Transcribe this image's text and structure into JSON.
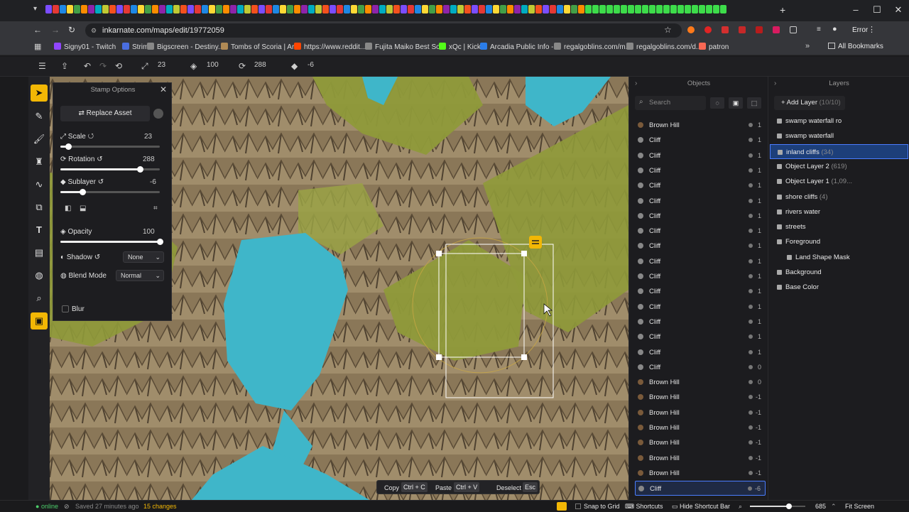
{
  "browser": {
    "url": "inkarnate.com/maps/edit/19772059",
    "profile": "Error",
    "bookmarks": [
      {
        "label": "Signy01 - Twitch",
        "color": "#9146ff"
      },
      {
        "label": "Strims",
        "color": "#4a6ee0"
      },
      {
        "label": "Bigscreen - Destiny...",
        "color": "#888888"
      },
      {
        "label": "Tombs of Scoria | Ar...",
        "color": "#b08a55"
      },
      {
        "label": "https://www.reddit...",
        "color": "#ff4500"
      },
      {
        "label": "Fujita Maiko Best So...",
        "color": "#888888"
      },
      {
        "label": "xQc | Kick",
        "color": "#53fc18"
      },
      {
        "label": "Arcadia Public Info -...",
        "color": "#2b7de9"
      },
      {
        "label": "regalgoblins.com/m...",
        "color": "#888888"
      },
      {
        "label": "regalgoblins.com/d...",
        "color": "#888888"
      },
      {
        "label": "patron",
        "color": "#f96854"
      }
    ],
    "all_bookmarks": "All Bookmarks"
  },
  "toolbar": {
    "scale_value": "23",
    "opacity_value": "100",
    "rotation_value": "288",
    "sublayer_value": "-6"
  },
  "stamp_options": {
    "title": "Stamp Options",
    "replace_asset": "Replace Asset",
    "scale_label": "Scale",
    "scale_value": "23",
    "scale_frac": 0.08,
    "rotation_label": "Rotation",
    "rotation_value": "288",
    "rotation_frac": 0.8,
    "sublayer_label": "Sublayer",
    "sublayer_value": "-6",
    "sublayer_frac": 0.22,
    "opacity_label": "Opacity",
    "opacity_value": "100",
    "opacity_frac": 1.0,
    "shadow_label": "Shadow",
    "shadow_value": "None",
    "blend_label": "Blend Mode",
    "blend_value": "Normal",
    "blur_label": "Blur"
  },
  "objects": {
    "title": "Objects",
    "search_placeholder": "Search",
    "items": [
      {
        "name": "Brown Hill",
        "count": "1"
      },
      {
        "name": "Cliff",
        "count": "1"
      },
      {
        "name": "Cliff",
        "count": "1"
      },
      {
        "name": "Cliff",
        "count": "1"
      },
      {
        "name": "Cliff",
        "count": "1"
      },
      {
        "name": "Cliff",
        "count": "1"
      },
      {
        "name": "Cliff",
        "count": "1"
      },
      {
        "name": "Cliff",
        "count": "1"
      },
      {
        "name": "Cliff",
        "count": "1"
      },
      {
        "name": "Cliff",
        "count": "1"
      },
      {
        "name": "Cliff",
        "count": "1"
      },
      {
        "name": "Cliff",
        "count": "1"
      },
      {
        "name": "Cliff",
        "count": "1"
      },
      {
        "name": "Cliff",
        "count": "1"
      },
      {
        "name": "Cliff",
        "count": "1"
      },
      {
        "name": "Cliff",
        "count": "1"
      },
      {
        "name": "Cliff",
        "count": "0"
      },
      {
        "name": "Brown Hill",
        "count": "0"
      },
      {
        "name": "Brown Hill",
        "count": "-1"
      },
      {
        "name": "Brown Hill",
        "count": "-1"
      },
      {
        "name": "Brown Hill",
        "count": "-1"
      },
      {
        "name": "Brown Hill",
        "count": "-1"
      },
      {
        "name": "Brown Hill",
        "count": "-1"
      },
      {
        "name": "Brown Hill",
        "count": "-1"
      },
      {
        "name": "Cliff",
        "count": "-6"
      }
    ]
  },
  "layers": {
    "title": "Layers",
    "add_layer": "Add Layer",
    "add_layer_count": "(10/10)",
    "items": [
      {
        "name": "swamp waterfall ro",
        "count": ""
      },
      {
        "name": "swamp waterfall",
        "count": ""
      },
      {
        "name": "inland cliffs",
        "count": "(34)"
      },
      {
        "name": "Object Layer 2",
        "count": "(619)"
      },
      {
        "name": "Object Layer 1",
        "count": "(1,09..."
      },
      {
        "name": "shore cliffs",
        "count": "(4)"
      },
      {
        "name": "rivers water",
        "count": ""
      },
      {
        "name": "streets",
        "count": ""
      },
      {
        "name": "Foreground",
        "count": ""
      },
      {
        "name": "Land Shape Mask",
        "count": ""
      },
      {
        "name": "Background",
        "count": ""
      },
      {
        "name": "Base Color",
        "count": ""
      }
    ]
  },
  "shortcuts": {
    "copy": "Copy",
    "copy_key": "Ctrl + C",
    "paste": "Paste",
    "paste_key": "Ctrl + V",
    "deselect": "Deselect",
    "deselect_key": "Esc"
  },
  "status": {
    "online": "online",
    "saved": "Saved 27 minutes ago",
    "changes": "15 changes",
    "snap": "Snap to Grid",
    "shortcuts": "Shortcuts",
    "hide_shortcut_bar": "Hide Shortcut Bar",
    "zoom": "685",
    "zoom_frac": 0.7,
    "fit": "Fit Screen"
  },
  "colors": {
    "accent": "#4a7dff",
    "save": "#f2b705",
    "water": "#3fb6c9",
    "grass": "#8f9a3a",
    "rock": "#8c7a5c"
  }
}
